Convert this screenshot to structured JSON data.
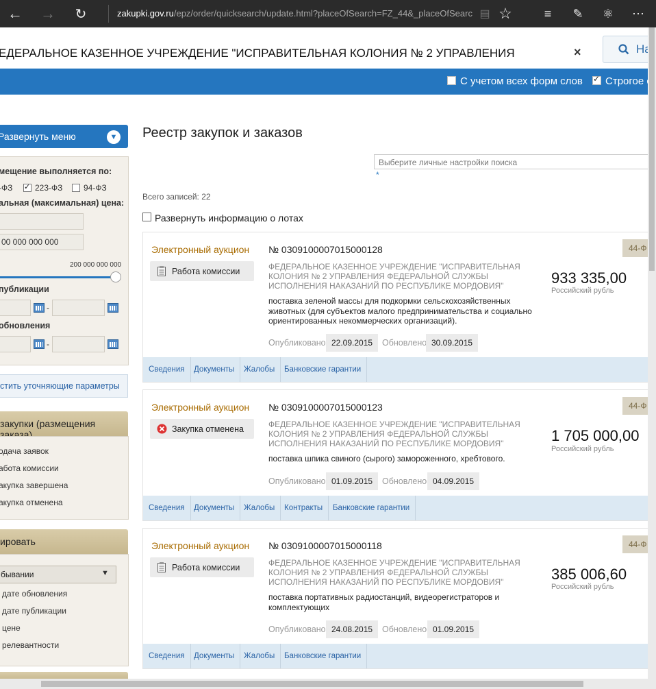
{
  "browser": {
    "url_host": "zakupki.gov.ru",
    "url_path": "/epz/order/quicksearch/update.html?placeOfSearch=FZ_44&_placeOfSearc"
  },
  "search": {
    "query": "ЕДЕРАЛЬНОЕ КАЗЕННОЕ УЧРЕЖДЕНИЕ \"ИСПРАВИТЕЛЬНАЯ КОЛОНИЯ № 2 УПРАВЛЕНИЯ",
    "clear": "×",
    "button_label": "На"
  },
  "options": {
    "word_forms": "С учетом всех форм слов",
    "strict": "Строгое с"
  },
  "sidebar": {
    "expand_menu": "Развернуть меню",
    "placement_label": "мещение выполняется по:",
    "laws": [
      "-ФЗ",
      "223-ФЗ",
      "94-ФЗ"
    ],
    "price_label": "альная (максимальная) цена:",
    "price_max_value": "00 000 000 000",
    "slider_max": "200 000 000 000",
    "publication_label": "публикации",
    "update_label": "обновления",
    "date_sep": "-",
    "reset_params": "стить уточняющие параметры",
    "stage_head": "закупки (размещения заказа)",
    "stages": [
      "одача заявок",
      "абота комиссии",
      "акупка завершена",
      "акупка отменена"
    ],
    "sort_head": "ировать",
    "sort_order": "бывании",
    "sort_options": [
      "дате обновления",
      "дате публикации",
      "цене",
      "релевантности"
    ]
  },
  "main": {
    "title": "Реестр закупок и заказов",
    "settings_placeholder": "Выберите личные настройки поиска",
    "settings_hint": "*",
    "total": "Всего записей: 22",
    "expand_lots": "Развернуть информацию о лотах"
  },
  "labels": {
    "published": "Опубликовано:",
    "updated": "Обновлено:",
    "currency": "Российский рубль",
    "law_tag": "44-Ф"
  },
  "cards": [
    {
      "type": "Электронный аукцион",
      "status": "Работа комиссии",
      "number": "№ 0309100007015000128",
      "org": "ФЕДЕРАЛЬНОЕ КАЗЕННОЕ УЧРЕЖДЕНИЕ \"ИСПРАВИТЕЛЬНАЯ КОЛОНИЯ № 2 УПРАВЛЕНИЯ ФЕДЕРАЛЬНОЙ СЛУЖБЫ ИСПОЛНЕНИЯ НАКАЗАНИЙ ПО РЕСПУБЛИКЕ МОРДОВИЯ\"",
      "desc": "поставка зеленой массы для подкормки сельскохозяйственных животных (для субъектов малого предпринимательства и социально ориентированных некоммерческих организаций).",
      "price": "933 335,00",
      "published": "22.09.2015",
      "updated": "30.09.2015",
      "tabs": [
        "Сведения",
        "Документы",
        "Жалобы",
        "Банковские гарантии"
      ]
    },
    {
      "type": "Электронный аукцион",
      "status": "Закупка отменена",
      "number": "№ 0309100007015000123",
      "org": "ФЕДЕРАЛЬНОЕ КАЗЕННОЕ УЧРЕЖДЕНИЕ \"ИСПРАВИТЕЛЬНАЯ КОЛОНИЯ № 2 УПРАВЛЕНИЯ ФЕДЕРАЛЬНОЙ СЛУЖБЫ ИСПОЛНЕНИЯ НАКАЗАНИЙ ПО РЕСПУБЛИКЕ МОРДОВИЯ\"",
      "desc": "поставка шпика свиного (сырого) замороженного, хребтового.",
      "price": "1 705 000,00",
      "published": "01.09.2015",
      "updated": "04.09.2015",
      "tabs": [
        "Сведения",
        "Документы",
        "Жалобы",
        "Контракты",
        "Банковские гарантии"
      ]
    },
    {
      "type": "Электронный аукцион",
      "status": "Работа комиссии",
      "number": "№ 0309100007015000118",
      "org": "ФЕДЕРАЛЬНОЕ КАЗЕННОЕ УЧРЕЖДЕНИЕ \"ИСПРАВИТЕЛЬНАЯ КОЛОНИЯ № 2 УПРАВЛЕНИЯ ФЕДЕРАЛЬНОЙ СЛУЖБЫ ИСПОЛНЕНИЯ НАКАЗАНИЙ ПО РЕСПУБЛИКЕ МОРДОВИЯ\"",
      "desc": "поставка портативных радиостанций, видеорегистраторов и комплектующих",
      "price": "385 006,60",
      "published": "24.08.2015",
      "updated": "01.09.2015",
      "tabs": [
        "Сведения",
        "Документы",
        "Жалобы",
        "Банковские гарантии"
      ]
    }
  ]
}
